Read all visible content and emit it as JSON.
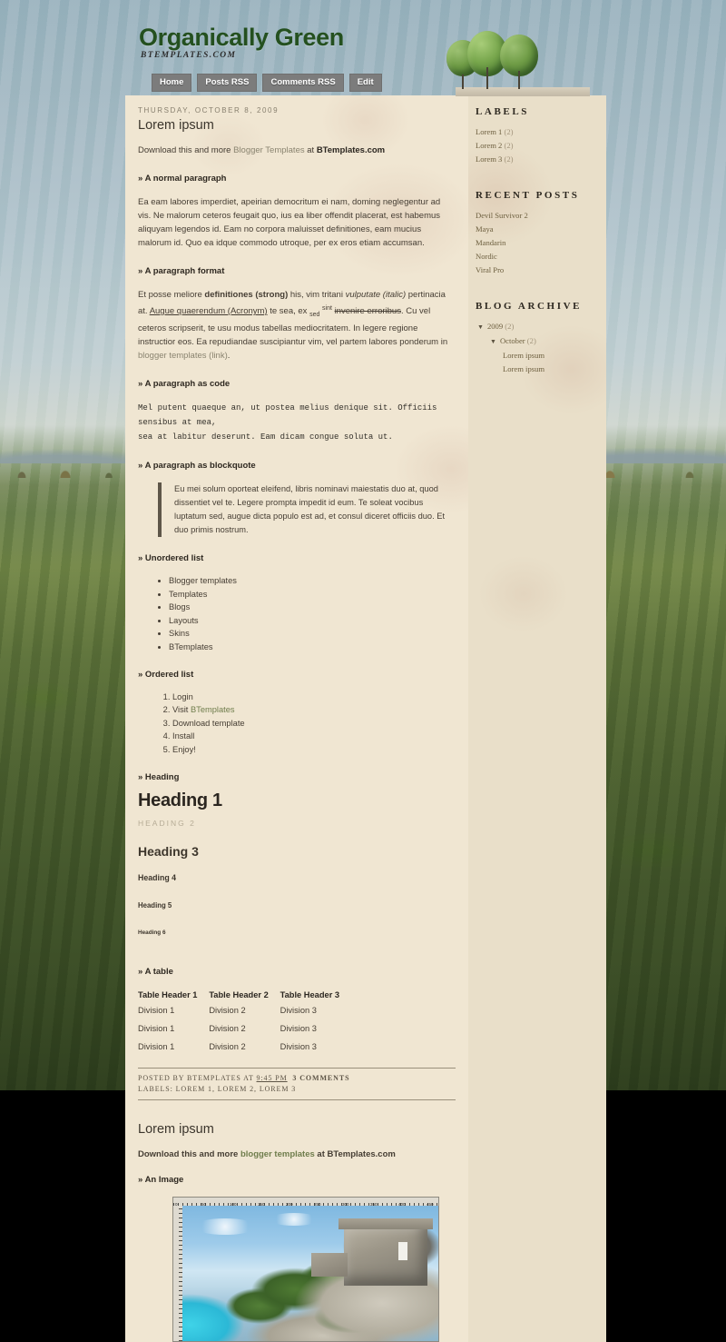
{
  "site": {
    "title": "Organically Green",
    "description": "BTEMPLATES.COM"
  },
  "nav": {
    "items": [
      {
        "label": "Home"
      },
      {
        "label": "Posts RSS"
      },
      {
        "label": "Comments RSS"
      },
      {
        "label": "Edit"
      }
    ]
  },
  "posts": [
    {
      "date": "Thursday, October 8, 2009",
      "title": "Lorem ipsum",
      "intro_pre": "Download this and more ",
      "intro_link": "Blogger Templates",
      "intro_mid": " at ",
      "intro_bold": "BTemplates.com",
      "sections": {
        "normal_paragraph": "» A normal paragraph",
        "normal_paragraph_text": "Ea eam labores imperdiet, apeirian democritum ei nam, doming neglegentur ad vis. Ne malorum ceteros feugait quo, ius ea liber offendit placerat, est habemus aliquyam legendos id. Eam no corpora maluisset definitiones, eam mucius malorum id. Quo ea idque commodo utroque, per ex eros etiam accumsan.",
        "paragraph_format": "» A paragraph format",
        "fmt_1": "Et posse meliore ",
        "fmt_strong": "definitiones (strong)",
        "fmt_2": " his, vim tritani ",
        "fmt_italic": "vulputate (italic)",
        "fmt_3": " pertinacia at. ",
        "fmt_acronym_a": "Augue quaerendum (Acronym)",
        "fmt_4": " te sea, ex ",
        "fmt_sub": "sed",
        "fmt_sup": "sint",
        "fmt_strike": "invenire erroribus",
        "fmt_5": ". Cu vel ceteros scripserit, te usu modus tabellas mediocritatem. In legere regione instructior eos. Ea repudiandae suscipiantur vim, vel partem labores ponderum in ",
        "fmt_link": "blogger templates (link)",
        "fmt_6": ".",
        "paragraph_code": "» A paragraph as code",
        "code_text": "Mel putent quaeque an, ut postea melius denique sit. Officiis sensibus at mea,\nsea at labitur deserunt. Eam dicam congue soluta ut.",
        "paragraph_blockquote": "» A paragraph as blockquote",
        "blockquote_text": "Eu mei solum oporteat eleifend, libris nominavi maiestatis duo at, quod dissentiet vel te. Legere prompta impedit id eum. Te soleat vocibus luptatum sed, augue dicta populo est ad, et consul diceret officiis duo. Et duo primis nostrum.",
        "unordered_list": "» Unordered list",
        "ul_items": [
          "Blogger templates",
          "Templates",
          "Blogs",
          "Layouts",
          "Skins",
          "BTemplates"
        ],
        "ordered_list": "» Ordered list",
        "ol_items": [
          {
            "text": "Login",
            "link": ""
          },
          {
            "pre": "Visit ",
            "link": "BTemplates"
          },
          {
            "text": "Download template",
            "link": ""
          },
          {
            "text": "Install",
            "link": ""
          },
          {
            "text": "Enjoy!",
            "link": ""
          }
        ],
        "heading_label": "» Heading",
        "h1": "Heading 1",
        "h2": "HEADING 2",
        "h3": "Heading 3",
        "h4": "Heading 4",
        "h5": "Heading 5",
        "h6": "Heading 6",
        "table_label": "» A table",
        "table": {
          "headers": [
            "Table Header 1",
            "Table Header 2",
            "Table Header 3"
          ],
          "rows": [
            [
              "Division 1",
              "Division 2",
              "Division 3"
            ],
            [
              "Division 1",
              "Division 2",
              "Division 3"
            ],
            [
              "Division 1",
              "Division 2",
              "Division 3"
            ]
          ]
        }
      },
      "footer": {
        "posted_by": "POSTED BY BTEMPLATES AT",
        "time": "9:45 PM",
        "comments": "3 COMMENTS",
        "labels": "LABELS: LOREM 1, LOREM 2, LOREM 3"
      }
    },
    {
      "title": "Lorem ipsum",
      "intro_pre": "Download this and more ",
      "intro_link": "blogger templates",
      "intro_mid": " at ",
      "intro_bold": "BTemplates.com",
      "image_label": "» An Image",
      "ruler_ticks": [
        "0",
        "50",
        "100",
        "150",
        "200",
        "250",
        "300",
        "350",
        "400",
        "450"
      ]
    }
  ],
  "sidebar": {
    "labels": {
      "heading": "Labels",
      "items": [
        {
          "name": "Lorem 1",
          "count": "(2)"
        },
        {
          "name": "Lorem 2",
          "count": "(2)"
        },
        {
          "name": "Lorem 3",
          "count": "(2)"
        }
      ]
    },
    "recent_posts": {
      "heading": "Recent Posts",
      "items": [
        "Devil Survivor 2",
        "Maya",
        "Mandarin",
        "Nordic",
        "Viral Pro"
      ]
    },
    "blog_archive": {
      "heading": "Blog Archive",
      "year": "2009",
      "year_count": "(2)",
      "month": "October",
      "month_count": "(2)",
      "entries": [
        "Lorem ipsum",
        "Lorem ipsum"
      ]
    }
  },
  "colors": {
    "title_green": "#24501f",
    "page_bg": "#f0e6d2",
    "sidebar_bg": "#e9dfc9",
    "nav_button": "#7c7c7c",
    "link_green": "#6f7d4c"
  }
}
